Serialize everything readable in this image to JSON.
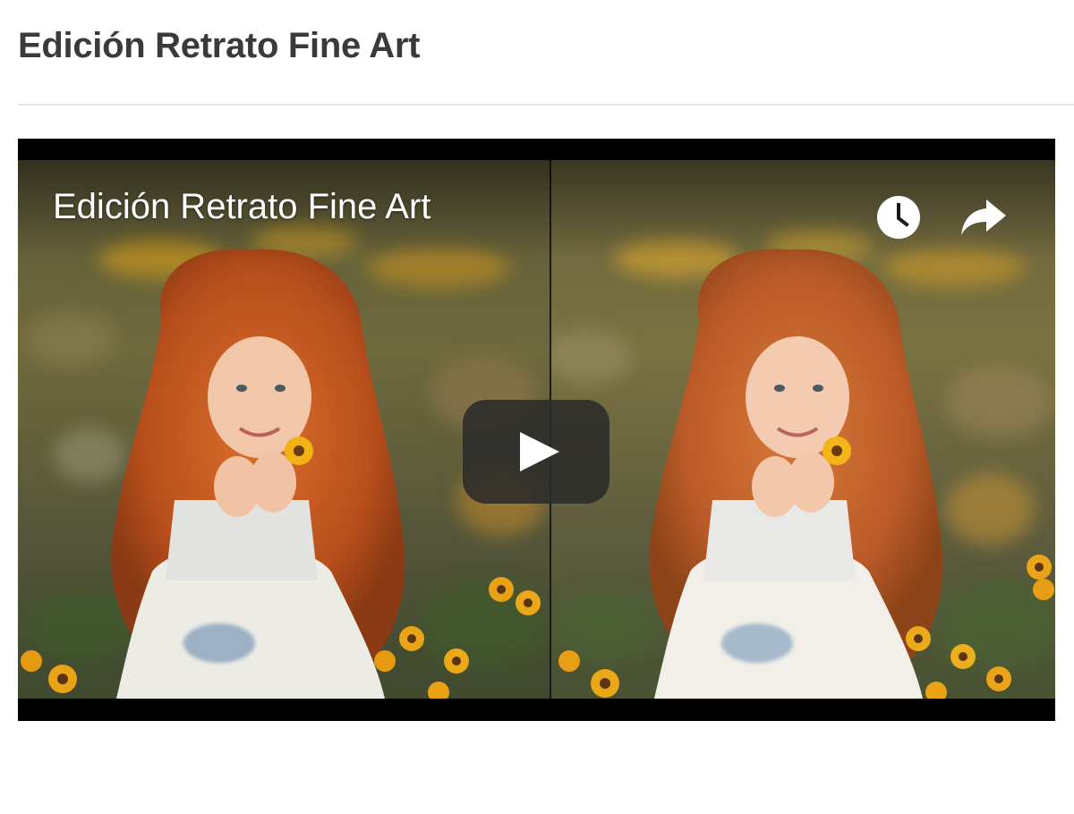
{
  "page": {
    "title": "Edición Retrato Fine Art"
  },
  "video": {
    "title": "Edición Retrato Fine Art",
    "icons": {
      "watch_later": "clock-icon",
      "share": "share-arrow-icon",
      "play": "play-icon"
    },
    "colors": {
      "letterbox": "#000000",
      "play_button_bg": "#2b2b2b",
      "title_text": "#ffffff"
    }
  }
}
